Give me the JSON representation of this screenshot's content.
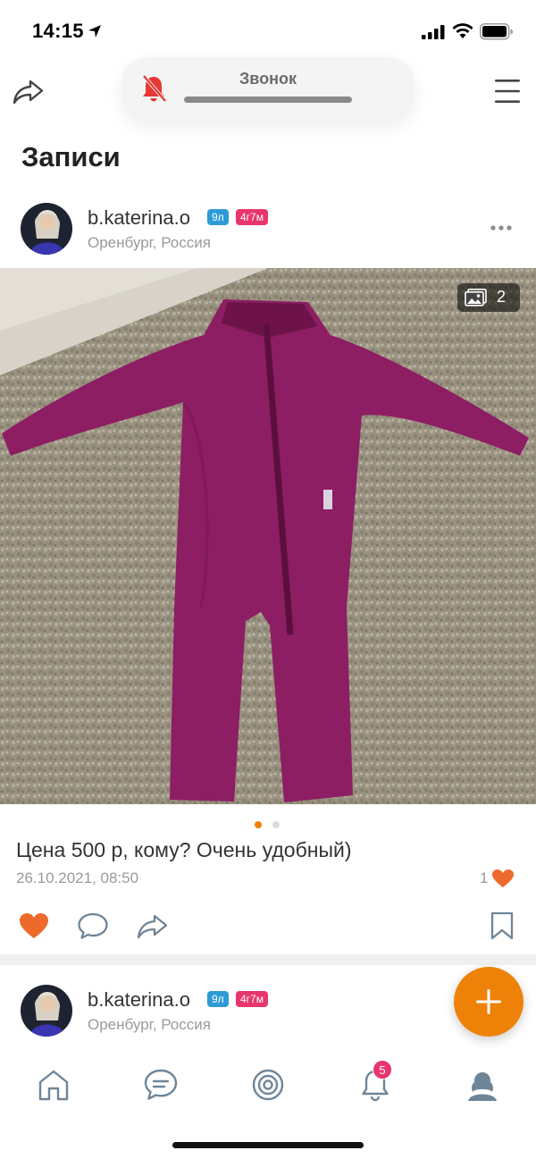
{
  "status_bar": {
    "time": "14:15",
    "icons": [
      "location-arrow-icon",
      "signal-icon",
      "wifi-icon",
      "battery-icon"
    ]
  },
  "header": {
    "share_icon": "share-arrow-icon",
    "menu_icon": "hamburger-menu-icon",
    "call_banner": {
      "label": "Звонок",
      "icon": "muted-bell-icon"
    }
  },
  "page_title": "Записи",
  "posts": [
    {
      "username": "b.katerina.o",
      "badges": [
        "9л",
        "4г7м"
      ],
      "location": "Оренбург, Россия",
      "photo_count": "2",
      "text": "Цена 500 р, кому? Очень удобный)",
      "date": "26.10.2021, 08:50",
      "likes": "1",
      "liked": true
    },
    {
      "username": "b.katerina.o",
      "badges": [
        "9л",
        "4г7м"
      ],
      "location": "Оренбург, Россия"
    }
  ],
  "carousel": {
    "total": 2,
    "active": 0
  },
  "fab_icon": "plus-icon",
  "tab_bar": {
    "tabs": [
      "home-icon",
      "chat-icon",
      "target-icon",
      "bell-icon",
      "profile-icon"
    ],
    "notification_count": "5"
  },
  "colors": {
    "accent": "#ee8208",
    "badge_blue": "#2f9bd6",
    "badge_pink": "#e8356e",
    "icon_blue": "#6e8598",
    "garment": "#8d1e63"
  }
}
